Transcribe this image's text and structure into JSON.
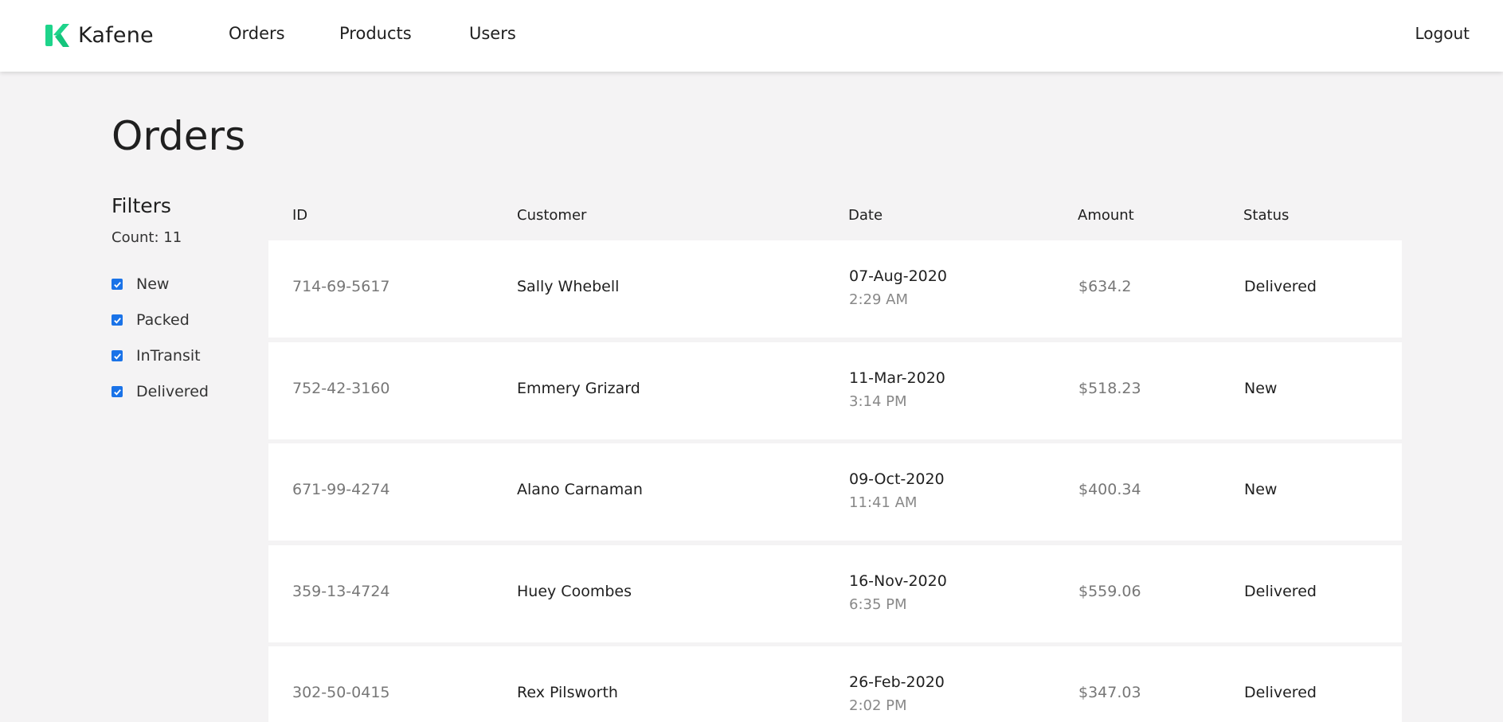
{
  "app": {
    "name": "Kafene",
    "brand_color": "#1ed48b"
  },
  "nav": {
    "orders": "Orders",
    "products": "Products",
    "users": "Users",
    "logout": "Logout"
  },
  "page": {
    "title": "Orders"
  },
  "filters": {
    "title": "Filters",
    "count_label": "Count: 11",
    "options": [
      {
        "label": "New",
        "checked": true
      },
      {
        "label": "Packed",
        "checked": true
      },
      {
        "label": "InTransit",
        "checked": true
      },
      {
        "label": "Delivered",
        "checked": true
      }
    ],
    "checkbox_color": "#1a73e8"
  },
  "table": {
    "headers": {
      "id": "ID",
      "customer": "Customer",
      "date": "Date",
      "amount": "Amount",
      "status": "Status"
    },
    "rows": [
      {
        "id": "714-69-5617",
        "customer": "Sally Whebell",
        "date": "07-Aug-2020",
        "time": "2:29 AM",
        "amount": "$634.2",
        "status": "Delivered"
      },
      {
        "id": "752-42-3160",
        "customer": "Emmery Grizard",
        "date": "11-Mar-2020",
        "time": "3:14 PM",
        "amount": "$518.23",
        "status": "New"
      },
      {
        "id": "671-99-4274",
        "customer": "Alano Carnaman",
        "date": "09-Oct-2020",
        "time": "11:41 AM",
        "amount": "$400.34",
        "status": "New"
      },
      {
        "id": "359-13-4724",
        "customer": "Huey Coombes",
        "date": "16-Nov-2020",
        "time": "6:35 PM",
        "amount": "$559.06",
        "status": "Delivered"
      },
      {
        "id": "302-50-0415",
        "customer": "Rex Pilsworth",
        "date": "26-Feb-2020",
        "time": "2:02 PM",
        "amount": "$347.03",
        "status": "Delivered"
      }
    ]
  }
}
